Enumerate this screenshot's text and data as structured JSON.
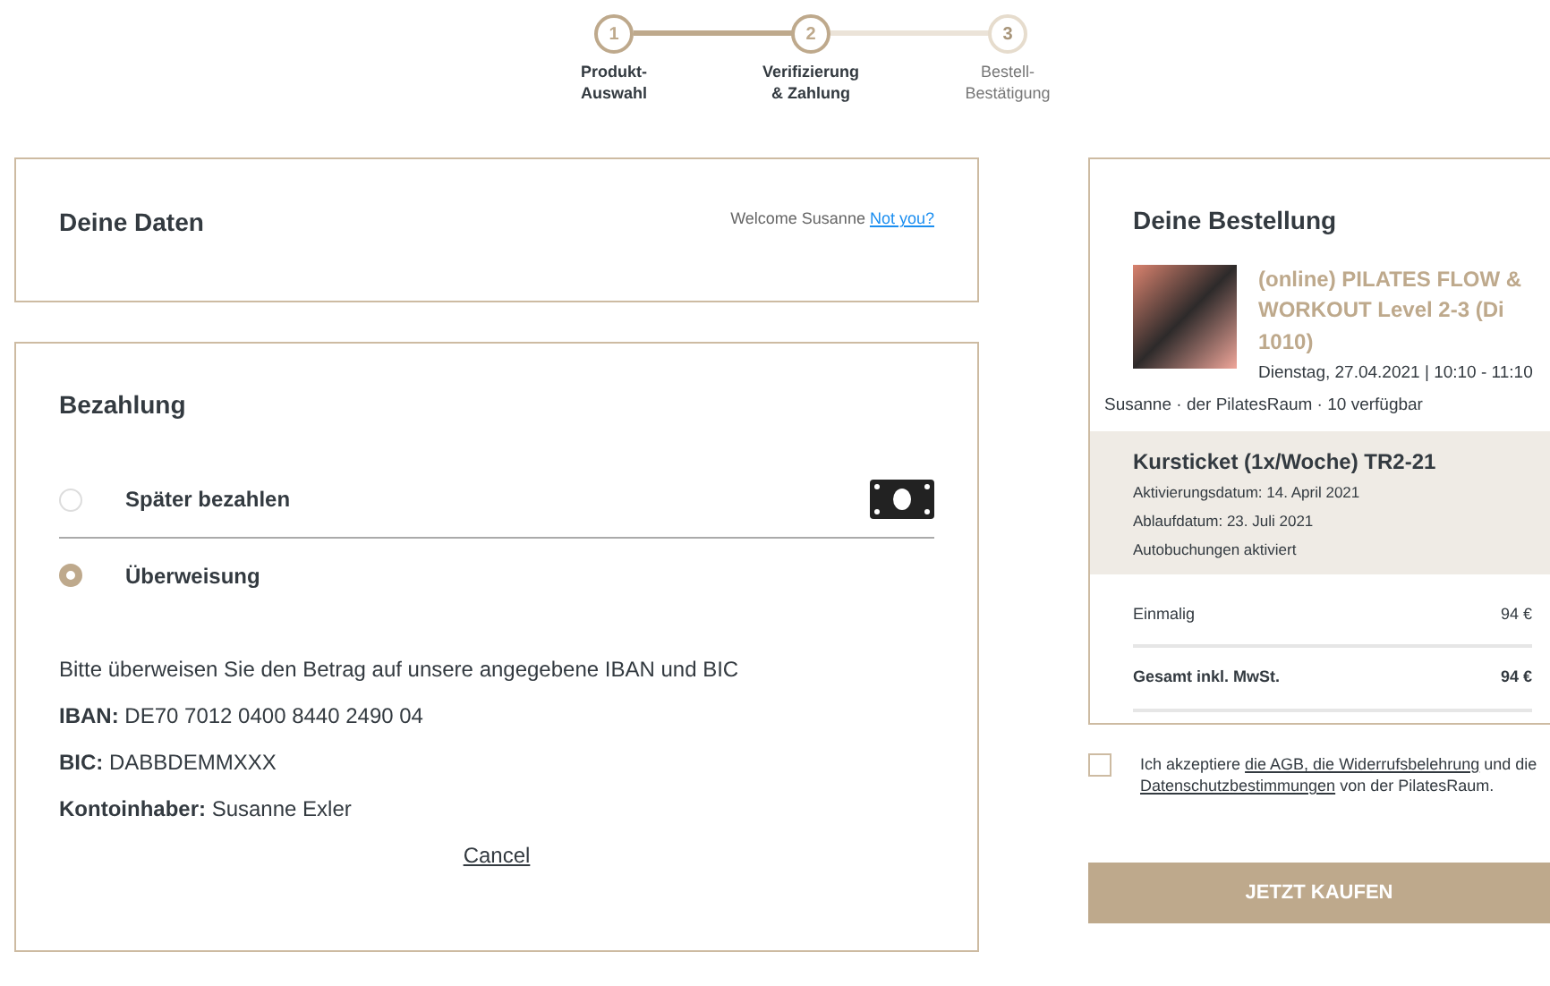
{
  "steps": [
    {
      "number": "1",
      "label": "Produkt-\nAuswahl",
      "reached": true
    },
    {
      "number": "2",
      "label": "Verifizierung\n& Zahlung",
      "reached": true
    },
    {
      "number": "3",
      "label": "Bestell-\nBestätigung",
      "reached": false
    }
  ],
  "details": {
    "title": "Deine Daten",
    "welcome": "Welcome Susanne",
    "link": "Not you?"
  },
  "payment": {
    "title": "Bezahlung",
    "options": [
      {
        "kind": "cash",
        "label": "Später bezahlen",
        "selected": false
      },
      {
        "kind": "transfer",
        "label": "Überweisung",
        "selected": true
      }
    ],
    "instructions": "Bitte überweisen Sie den Betrag auf unsere angegebene IBAN und BIC",
    "fields": [
      {
        "label": "IBAN:",
        "value": "DE70 7012 0400 8440 2490 04"
      },
      {
        "label": "BIC:",
        "value": "DABBDEMMXXX"
      },
      {
        "label": "Kontoinhaber:",
        "value": "Susanne Exler"
      }
    ],
    "cancel": "Cancel"
  },
  "order": {
    "title": "Deine Bestellung",
    "course": "(online) PILATES FLOW & WORKOUT Level 2-3 (Di 1010)",
    "date": "Dienstag, 27.04.2021 | 10:10 - 11:10",
    "meta": "Susanne · der PilatesRaum · 10 verfügbar",
    "ticket": {
      "name": "Kursticket (1x/Woche) TR2-21",
      "lines": [
        "Aktivierungsdatum: 14. April 2021",
        "Ablaufdatum: 23. Juli 2021",
        "Autobuchungen aktiviert"
      ]
    },
    "totals": [
      {
        "label": "Einmalig",
        "amount": "94 €",
        "bold": false
      },
      {
        "label": "Gesamt inkl. MwSt.",
        "amount": "94 €",
        "bold": true
      }
    ]
  },
  "agreement": {
    "checked": false,
    "parts": [
      {
        "text": "Ich akzeptiere ",
        "link": false
      },
      {
        "text": "die AGB, die Widerrufsbelehrung",
        "link": true
      },
      {
        "text": " und die ",
        "link": false
      },
      {
        "text": "Datenschutzbestimmungen",
        "link": true
      },
      {
        "text": " von der PilatesRaum.",
        "link": false
      }
    ]
  },
  "buy_button": "JETZT KAUFEN"
}
